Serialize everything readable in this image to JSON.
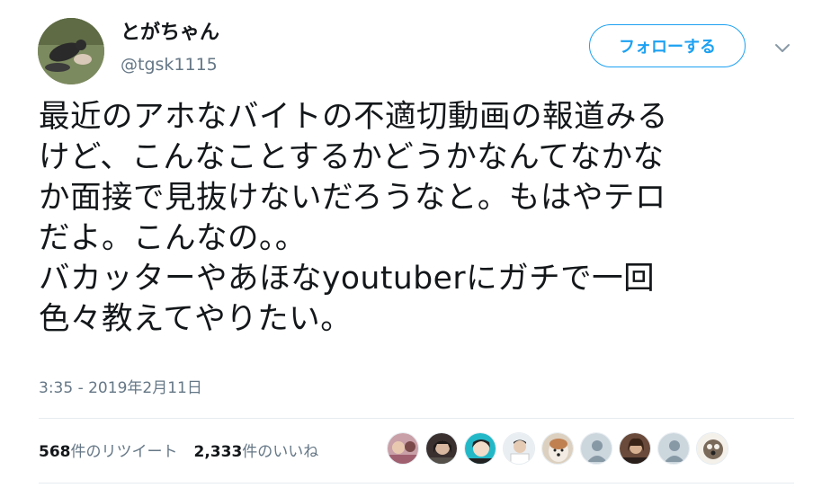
{
  "tweet": {
    "display_name": "とがちゃん",
    "handle": "@tgsk1115",
    "follow_label": "フォローする",
    "text_lines": [
      "最近のアホなバイトの不適切動画の報道みる",
      "けど、こんなことするかどうかなんてなかな",
      "か面接で見抜けないだろうなと。もはやテロ",
      "だよ。こんなの。。",
      "バカッターやあほなyoutuberにガチで一回",
      "色々教えてやりたい。"
    ],
    "timestamp": "3:35 - 2019年2月11日",
    "retweets_count": "568",
    "retweets_label": "件のリツイート",
    "likes_count": "2,333",
    "likes_label": "件のいいね"
  },
  "icons": {
    "avatar": "profile-photo",
    "caret": "chevron-down-icon",
    "likers": [
      "liker-avatar",
      "liker-avatar",
      "liker-avatar",
      "liker-avatar",
      "liker-avatar",
      "default-egg-avatar",
      "liker-avatar",
      "default-egg-avatar",
      "liker-avatar"
    ]
  },
  "colors": {
    "accent": "#1da1f2",
    "secondary_text": "#657786",
    "divider": "#e6ecf0"
  }
}
